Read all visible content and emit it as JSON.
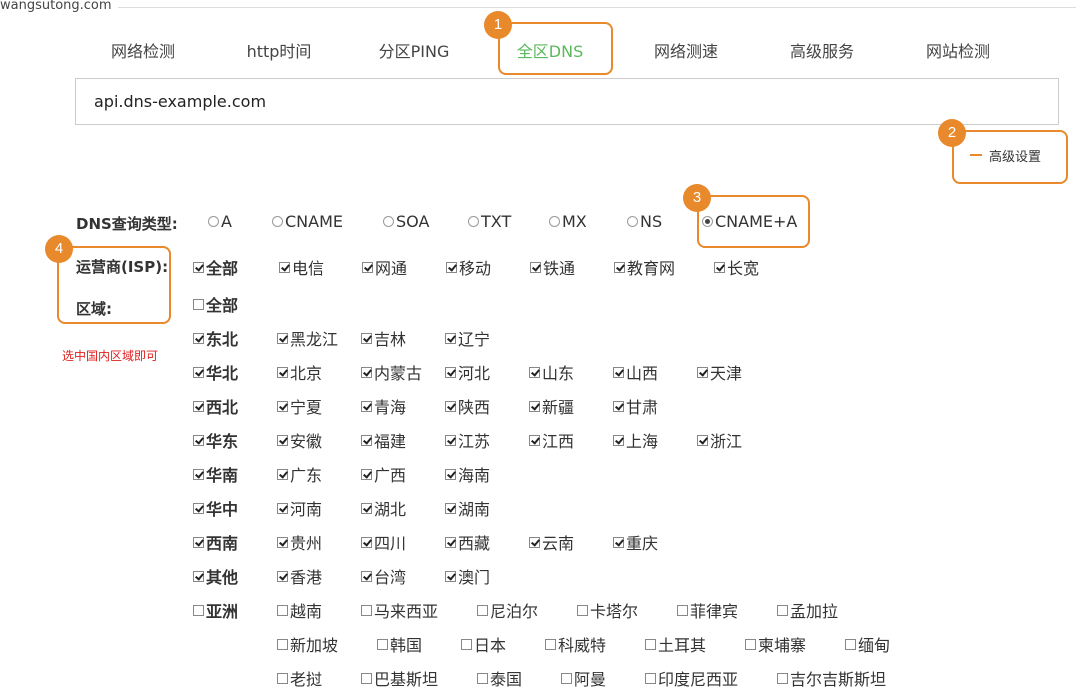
{
  "site": "wangsutong.com",
  "tabs": [
    "网络检测",
    "http时间",
    "分区PING",
    "全区DNS",
    "网络测速",
    "高级服务",
    "网站检测"
  ],
  "active_tab": "全区DNS",
  "domain_input": {
    "value": "api.dns-example.com"
  },
  "advanced_settings": "高级设置",
  "dns_type": {
    "label": "DNS查询类型:",
    "options": [
      "A",
      "CNAME",
      "SOA",
      "TXT",
      "MX",
      "NS",
      "CNAME+A"
    ],
    "selected": "CNAME+A"
  },
  "isp": {
    "label": "运营商(ISP):",
    "options": [
      {
        "label": "全部",
        "checked": true
      },
      {
        "label": "电信",
        "checked": true
      },
      {
        "label": "网通",
        "checked": true
      },
      {
        "label": "移动",
        "checked": true
      },
      {
        "label": "铁通",
        "checked": true
      },
      {
        "label": "教育网",
        "checked": true
      },
      {
        "label": "长宽",
        "checked": true
      }
    ]
  },
  "region": {
    "label": "区域:",
    "all_label": "全部",
    "all_checked": false,
    "tip": "选中国内区域即可",
    "groups": [
      {
        "name": "东北",
        "checked": true,
        "items": [
          "黑龙江",
          "吉林",
          "辽宁"
        ],
        "items_checked": true
      },
      {
        "name": "华北",
        "checked": true,
        "items": [
          "北京",
          "内蒙古",
          "河北",
          "山东",
          "山西",
          "天津"
        ],
        "items_checked": true
      },
      {
        "name": "西北",
        "checked": true,
        "items": [
          "宁夏",
          "青海",
          "陕西",
          "新疆",
          "甘肃"
        ],
        "items_checked": true
      },
      {
        "name": "华东",
        "checked": true,
        "items": [
          "安徽",
          "福建",
          "江苏",
          "江西",
          "上海",
          "浙江"
        ],
        "items_checked": true
      },
      {
        "name": "华南",
        "checked": true,
        "items": [
          "广东",
          "广西",
          "海南"
        ],
        "items_checked": true
      },
      {
        "name": "华中",
        "checked": true,
        "items": [
          "河南",
          "湖北",
          "湖南"
        ],
        "items_checked": true
      },
      {
        "name": "西南",
        "checked": true,
        "items": [
          "贵州",
          "四川",
          "西藏",
          "云南",
          "重庆"
        ],
        "items_checked": true
      },
      {
        "name": "其他",
        "checked": true,
        "items": [
          "香港",
          "台湾",
          "澳门"
        ],
        "items_checked": true
      },
      {
        "name": "亚洲",
        "checked": false,
        "items": [
          "越南",
          "马来西亚",
          "尼泊尔",
          "卡塔尔",
          "菲律宾",
          "孟加拉",
          "新加坡",
          "韩国",
          "日本",
          "科威特",
          "土耳其",
          "柬埔寨",
          "缅甸",
          "老挝",
          "巴基斯坦",
          "泰国",
          "阿曼",
          "印度尼西亚",
          "吉尔吉斯斯坦"
        ],
        "items_checked": false
      }
    ]
  },
  "callouts": [
    "1",
    "2",
    "3",
    "4"
  ],
  "colors": {
    "accent": "#e8892b",
    "active_tab": "#5cb85c",
    "tip": "#e02020"
  }
}
